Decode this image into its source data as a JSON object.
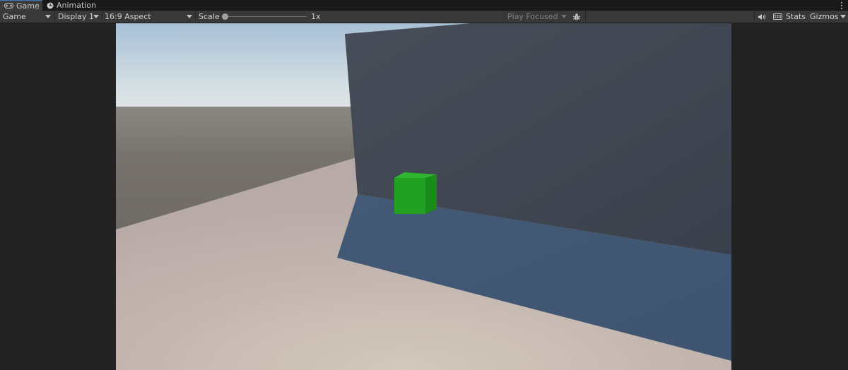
{
  "tabs": [
    {
      "label": "Game",
      "icon": "gamepad-icon",
      "active": true
    },
    {
      "label": "Animation",
      "icon": "clock-icon",
      "active": false
    }
  ],
  "toolbar": {
    "game_dropdown": "Game",
    "display_dropdown": "Display 1",
    "aspect_dropdown": "16:9 Aspect",
    "scale_label": "Scale",
    "scale_value": "1x",
    "scale_fraction": 0.0,
    "play_mode_dropdown": "Play Focused",
    "stats_label": "Stats",
    "gizmos_label": "Gizmos"
  },
  "colors": {
    "panel_bg": "#232323",
    "toolbar_bg": "#383838",
    "tabbar_bg": "#191919",
    "cube_green": "#24a224",
    "wall_blue_gray": "#3f4651",
    "shadow_blue": "#415773"
  },
  "icons": {
    "bug": "bug-icon",
    "mute": "speaker-icon",
    "keyboard": "keyboard-icon",
    "more": "more-vertical-icon"
  }
}
